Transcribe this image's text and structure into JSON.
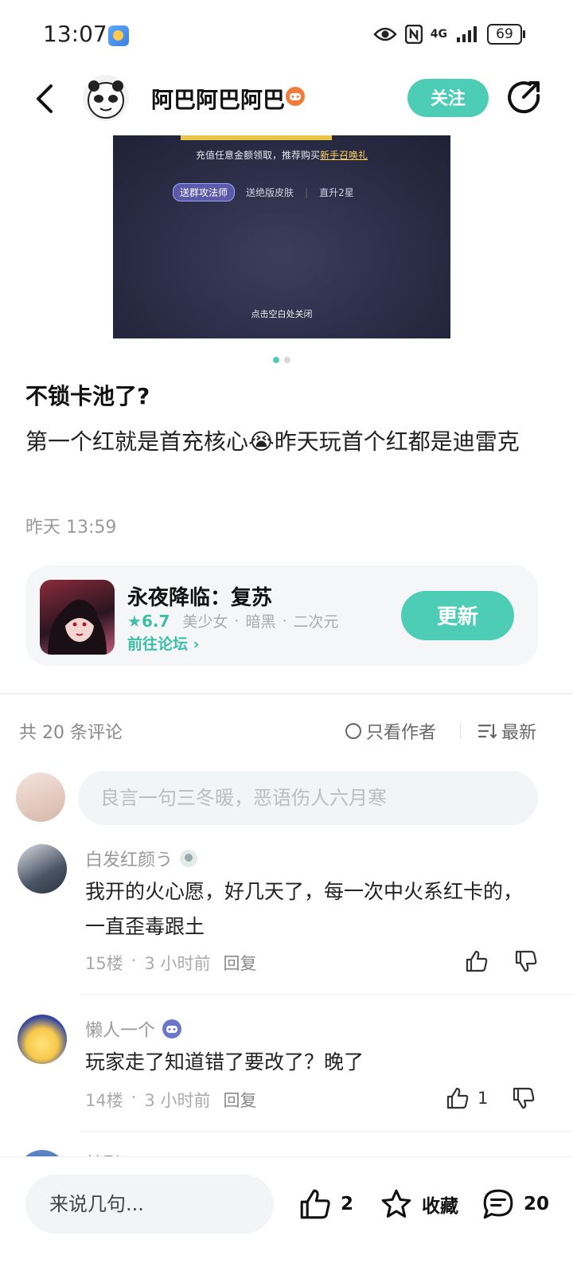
{
  "status_bar": {
    "time": "13:07",
    "network": "4G",
    "battery": "69"
  },
  "header": {
    "author_name": "阿巴阿巴阿巴",
    "follow_label": "关注"
  },
  "image": {
    "line1_prefix": "充值任意金额领取，推荐购买",
    "line1_link": "新手召唤礼",
    "tabs": [
      "送群攻法师",
      "送绝版皮肤",
      "直升2星"
    ],
    "close_hint": "点击空白处关闭",
    "page_count": 2,
    "current_page": 1
  },
  "post": {
    "title": "不锁卡池了?",
    "body_part1": "第一个红就是首充核心",
    "body_emoji": "😭",
    "body_part2": "昨天玩首个红都是迪雷克",
    "time": "昨天 13:59"
  },
  "game_card": {
    "name": "永夜降临：复苏",
    "rating": "6.7",
    "tags": [
      "美少女",
      "暗黑",
      "二次元"
    ],
    "forum_link": "前往论坛",
    "update_label": "更新"
  },
  "comments_header": {
    "count_text": "共 20 条评论",
    "author_only": "只看作者",
    "sort": "最新"
  },
  "comment_input": {
    "placeholder": "良言一句三冬暖，恶语伤人六月寒"
  },
  "comments": [
    {
      "user": "白发红颜う",
      "text": "我开的火心愿，好几天了，每一次中火系红卡的，一直歪毒跟土",
      "floor": "15楼",
      "time": "3 小时前",
      "reply": "回复",
      "likes": ""
    },
    {
      "user": "懒人一个",
      "text": "玩家走了知道错了要改了？晚了",
      "floor": "14楼",
      "time": "3 小时前",
      "reply": "回复",
      "likes": "1"
    },
    {
      "user": "林影",
      "text": "",
      "floor": "",
      "time": "",
      "reply": "",
      "likes": ""
    }
  ],
  "bottom_bar": {
    "input_placeholder": "来说几句...",
    "like_count": "2",
    "favorite_label": "收藏",
    "comment_count": "20"
  },
  "colors": {
    "accent": "#4ecdb6",
    "accent_text": "#3dbfa7",
    "badge_orange": "#f27a3a"
  }
}
